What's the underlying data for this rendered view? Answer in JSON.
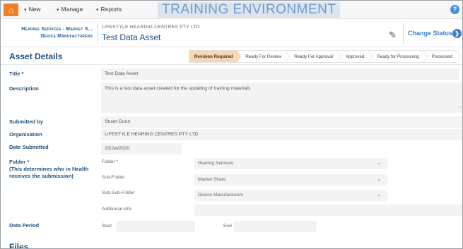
{
  "nav": {
    "home_icon": "home-icon",
    "new_label": "New",
    "manage_label": "Manage",
    "reports_label": "Reports",
    "environment_banner": "TRAINING ENVIRONMENT",
    "help_icon": "help-icon"
  },
  "header": {
    "breadcrumb_line1": "Hearing Services - Market S...",
    "breadcrumb_line2": "Device Manufacturers",
    "organisation": "LIFESTYLE HEARING CENTRES PTY LTD",
    "asset_title": "Test Data Asset",
    "change_status_label": "Change Status"
  },
  "section": {
    "title": "Asset Details",
    "steps": [
      "Revision Required",
      "Ready For Review",
      "Ready For Approval",
      "Approved",
      "Ready for Processing",
      "Processed"
    ],
    "active_step": "Revision Required"
  },
  "form": {
    "title_label": "Title *",
    "title_value": "Test Data Asset",
    "description_label": "Description",
    "description_value": "This is a test data asset created for the updating of training materials",
    "submitted_by_label": "Submitted by",
    "submitted_by_value": "Stuart Dunn",
    "organisation_label": "Organisation",
    "organisation_value": "LIFESTYLE HEARING CENTRES PTY LTD",
    "date_submitted_label": "Date Submitted",
    "date_submitted_value": "15/Jul/2020",
    "folder_label": "Folder *",
    "folder_note": "(This determines who in Health receives the submission)",
    "folder_sub_label": "Folder *",
    "folder_value": "Hearing Services",
    "subfolder_label": "Sub-Folder",
    "subfolder_value": "Market Share",
    "subsubfolder_label": "Sub-Sub-Folder",
    "subsubfolder_value": "Device Manufacturers",
    "additional_info_label": "Additional info",
    "additional_info_value": "",
    "data_period_label": "Data Period",
    "start_label": "Start",
    "start_value": "",
    "end_label": "End",
    "end_value": ""
  },
  "files_title": "Files",
  "colors": {
    "accent": "#f07f21",
    "link_blue": "#3b7fc4",
    "heading_blue": "#1f4e79",
    "active_step": "#fbd7b0"
  }
}
